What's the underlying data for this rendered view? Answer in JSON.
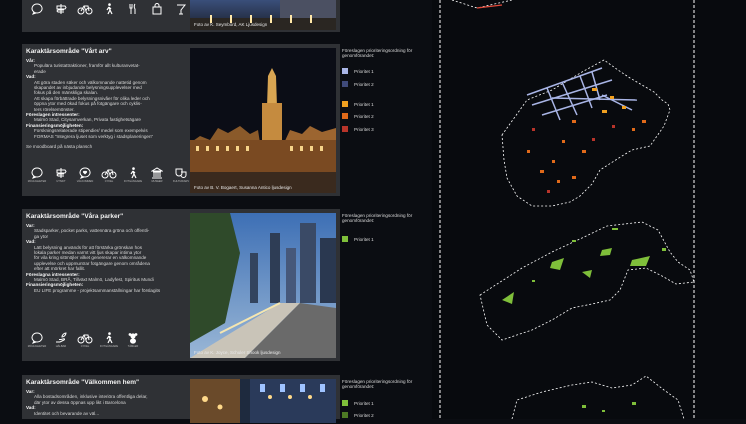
{
  "top": {
    "icon_labels": [
      "",
      "",
      "",
      "",
      "",
      "",
      "",
      ""
    ],
    "caption": "Foto av K. Seymbord, AK Ljusdesign"
  },
  "areas": [
    {
      "title": "Karaktärsområde \"Vårt arv\"",
      "lines": [
        {
          "t": "Vår:",
          "h": true
        },
        {
          "t": "Populära turistattraktioner, framför allt kulturanvetat-",
          "i": true
        },
        {
          "t": "erade",
          "i": true
        },
        {
          "t": "Vad:",
          "h": true
        },
        {
          "t": "Att göra staden säker och välkomnande nattetid genom",
          "i": true
        },
        {
          "t": "skapandet av inbjudande belysningsupplevelser med",
          "i": true
        },
        {
          "t": "fokus på den mänskliga skalan.",
          "i": true
        },
        {
          "t": "Att skapa förbättrade belysningsnivåer för olika leder och",
          "i": true
        },
        {
          "t": "öppna ytor med ökad fokus på fotgängare och cyklis-",
          "i": true
        },
        {
          "t": "ters rörelsemönster.",
          "i": true
        },
        {
          "t": "Föreslagen intressenter:",
          "h": true
        },
        {
          "t": "Malmö Stad, Citysamverkan, Privata fastighetsägare",
          "i": true
        },
        {
          "t": "Finansieringsmöjligheten:",
          "h": true
        },
        {
          "t": "Forskningsrelaterade stipendier/ medel som exempelvis",
          "i": true
        },
        {
          "t": "FORMAS \"Integrera ljuset som verktyg i stadsplaneringen\"",
          "i": true
        },
        {
          "t": "",
          "i": false
        },
        {
          "t": "Se moodboard på nästa plansch",
          "i": false
        }
      ],
      "icon_labels": [
        "MÖJLIGHETER",
        "UTSIKT",
        "VÄLKOMMEN",
        "CYKEL",
        "FOTGÄNGARE",
        "MUSEER",
        "KULTUR/ARV"
      ],
      "caption": "Foto av B. V. Bogaert, Susanna Antico ljusdesign",
      "legend_title": "Föreslagen prioriteringsordning för genomförandet:",
      "legend": [
        {
          "label": "Prioritet 1",
          "color": "#a9b5e6"
        },
        {
          "label": "Prioritet 2",
          "color": "#3f4a7a"
        },
        {
          "label": "Prioritet 1",
          "color": "#f0a020"
        },
        {
          "label": "Prioritet 2",
          "color": "#e06a1a"
        },
        {
          "label": "Prioritet 3",
          "color": "#b8342a"
        }
      ]
    },
    {
      "title": "Karaktärsområde \"Våra parker\"",
      "lines": [
        {
          "t": "Var:",
          "h": true
        },
        {
          "t": "Stadsparker, pocket parks, vattennära gröna och offentli-",
          "i": true
        },
        {
          "t": "ga ytor",
          "i": true
        },
        {
          "t": "Vad:",
          "h": true
        },
        {
          "t": "Lätt belysning används för att förstärka grönskan hos",
          "i": true
        },
        {
          "t": "lokala parker medan varmt vitt ljus skapar intima ytor",
          "i": true
        },
        {
          "t": "för vila kring sittmöjler vilket genererar en välkomnande",
          "i": true
        },
        {
          "t": "upplevelse och uppmuntrar fotgängare genom områdena",
          "i": true
        },
        {
          "t": "efter att mörkret har fallit.",
          "i": true
        },
        {
          "t": "Föreslagna intressenter:",
          "h": true
        },
        {
          "t": "Malmö Stad, BRÅ, Tillväxt Malmö, Ladyfest, Spiritus Mundi",
          "i": true
        },
        {
          "t": "Finansieringsmöjligheten:",
          "h": true
        },
        {
          "t": "EU LIFE programme - projektsammanställningar har förslagits",
          "i": true
        }
      ],
      "icon_labels": [
        "MÖJLIGHETER",
        "HÅLBAR",
        "CYKEL",
        "FOTGÄNGARE",
        "TÄMLER"
      ],
      "caption": "Foto av K. Joyce, Schuler Shook ljusdesign",
      "legend_title": "Föreslagen prioriteringsordning för genomförandet:",
      "legend": [
        {
          "label": "Prioritet 1",
          "color": "#7fbf3a"
        }
      ]
    },
    {
      "title": "Karaktärsområde \"Välkommen hem\"",
      "lines": [
        {
          "t": "Var:",
          "h": true
        },
        {
          "t": "Alla bostadsområden, inklusive interiöra offentliga delar,",
          "i": true
        },
        {
          "t": "där ytor av dessa öppnas upp likt i Barcelona",
          "i": true
        },
        {
          "t": "Vad:",
          "h": true
        },
        {
          "t": "Identitet och bevarande av väl...",
          "i": true
        }
      ],
      "legend_title": "Föreslagen prioriteringsordning för genomförandet:",
      "legend": [
        {
          "label": "Prioritet 1",
          "color": "#7fbf3a"
        },
        {
          "label": "Prioritet 2",
          "color": "#4d7a24"
        }
      ]
    }
  ]
}
